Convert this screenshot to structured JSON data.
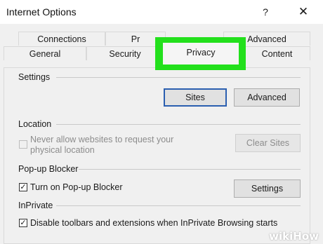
{
  "window": {
    "title": "Internet Options",
    "help_glyph": "?",
    "close_glyph": "✕"
  },
  "tabs": {
    "row1": [
      "Connections",
      "Pr",
      "Advanced"
    ],
    "row2": [
      "General",
      "Security",
      "Privacy",
      "Content"
    ],
    "selected": "Privacy",
    "highlight_color": "#23e01c"
  },
  "settings": {
    "label": "Settings",
    "sites_button": "Sites",
    "advanced_button": "Advanced"
  },
  "location": {
    "label": "Location",
    "checkbox_label_line1": "Never allow websites to request your",
    "checkbox_label_line2": "physical location",
    "checked": false,
    "clear_sites_button": "Clear Sites"
  },
  "popup": {
    "label": "Pop-up Blocker",
    "checkbox_label": "Turn on Pop-up Blocker",
    "checked": true,
    "settings_button": "Settings"
  },
  "inprivate": {
    "label": "InPrivate",
    "checkbox_label": "Disable toolbars and extensions when InPrivate Browsing starts",
    "checked": true
  },
  "watermark": {
    "wiki": "wiki",
    "how": "How"
  }
}
